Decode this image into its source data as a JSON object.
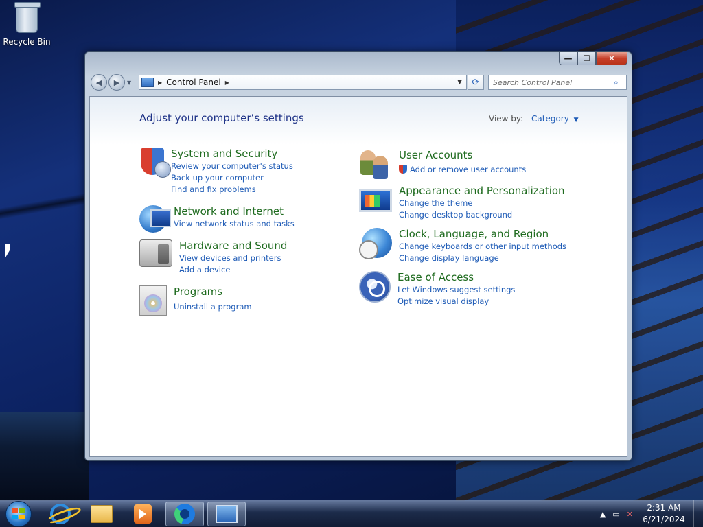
{
  "desktop": {
    "recycle_bin_label": "Recycle Bin"
  },
  "window": {
    "caption": {
      "minimize": "—",
      "maximize": "☐",
      "close": "✕"
    },
    "address": {
      "crumb": "Control Panel"
    },
    "search": {
      "placeholder": "Search Control Panel"
    },
    "title": "Adjust your computer’s settings",
    "view_by": {
      "label": "View by:",
      "value": "Category"
    },
    "categories_left": [
      {
        "heading": "System and Security",
        "links": [
          "Review your computer's status",
          "Back up your computer",
          "Find and fix problems"
        ],
        "icon": "shield-icon"
      },
      {
        "heading": "Network and Internet",
        "links": [
          "View network status and tasks"
        ],
        "icon": "network-icon"
      },
      {
        "heading": "Hardware and Sound",
        "links": [
          "View devices and printers",
          "Add a device"
        ],
        "icon": "printer-icon"
      },
      {
        "heading": "Programs",
        "links": [
          "Uninstall a program"
        ],
        "icon": "programs-icon"
      }
    ],
    "categories_right": [
      {
        "heading": "User Accounts",
        "links": [
          "Add or remove user accounts"
        ],
        "icon": "users-icon"
      },
      {
        "heading": "Appearance and Personalization",
        "links": [
          "Change the theme",
          "Change desktop background"
        ],
        "icon": "appearance-icon"
      },
      {
        "heading": "Clock, Language, and Region",
        "links": [
          "Change keyboards or other input methods",
          "Change display language"
        ],
        "icon": "clock-globe-icon"
      },
      {
        "heading": "Ease of Access",
        "links": [
          "Let Windows suggest settings",
          "Optimize visual display"
        ],
        "icon": "ease-of-access-icon"
      }
    ]
  },
  "taskbar": {
    "time": "2:31 AM",
    "date": "6/21/2024",
    "pinned": [
      "internet-explorer-icon",
      "file-explorer-icon",
      "media-player-icon",
      "edge-icon",
      "control-panel-icon"
    ]
  },
  "colors": {
    "heading_green": "#1f6b1f",
    "link_blue": "#1e5bb6",
    "title_blue": "#1e3287"
  }
}
